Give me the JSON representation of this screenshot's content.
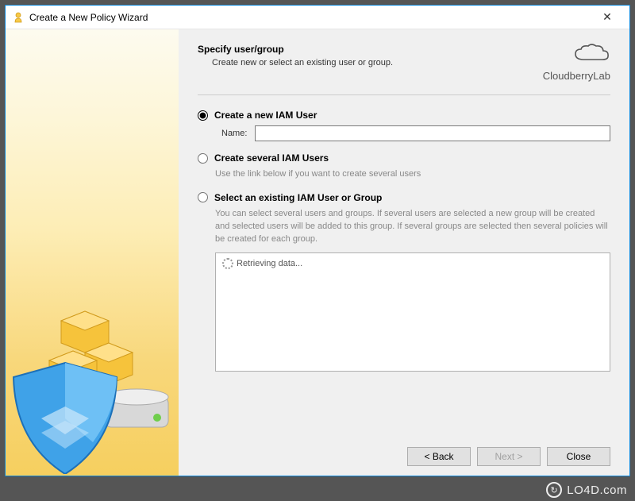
{
  "window": {
    "title": "Create a New Policy Wizard",
    "close_label": "✕"
  },
  "header": {
    "title": "Specify user/group",
    "subtitle": "Create new or select an existing user or group.",
    "brand": "CloudberryLab"
  },
  "options": {
    "create_user": {
      "label": "Create a new IAM User",
      "name_label": "Name:",
      "name_value": ""
    },
    "create_several": {
      "label": "Create several IAM Users",
      "desc": "Use the link below if you want to create several users"
    },
    "select_existing": {
      "label": "Select an existing IAM User or Group",
      "desc": "You can select several users and groups. If several users are selected a new group will be created and selected users will be added to this group. If several groups are selected then several policies will be created for each group.",
      "loading": "Retrieving data..."
    }
  },
  "buttons": {
    "back": "< Back",
    "next": "Next >",
    "close": "Close"
  },
  "watermark": "LO4D.com"
}
